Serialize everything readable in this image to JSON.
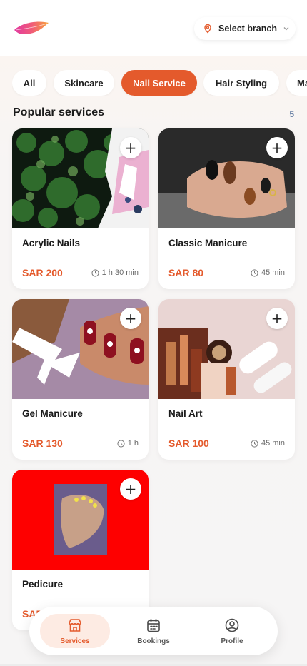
{
  "header": {
    "branch_label": "Select branch",
    "icons": [
      "feather-logo",
      "location-pin-icon",
      "chevron-down-icon"
    ]
  },
  "tabs": [
    {
      "label": "All",
      "active": false
    },
    {
      "label": "Skincare",
      "active": false
    },
    {
      "label": "Nail Service",
      "active": true
    },
    {
      "label": "Hair Styling",
      "active": false
    },
    {
      "label": "Ma",
      "active": false
    }
  ],
  "section": {
    "title": "Popular services",
    "count": "5"
  },
  "services": [
    {
      "name": "Acrylic Nails",
      "price": "SAR 200",
      "duration": "1 h 30 min"
    },
    {
      "name": "Classic Manicure",
      "price": "SAR 80",
      "duration": "45 min"
    },
    {
      "name": "Gel Manicure",
      "price": "SAR 130",
      "duration": "1 h"
    },
    {
      "name": "Nail Art",
      "price": "SAR 100",
      "duration": "45 min"
    },
    {
      "name": "Pedicure",
      "price": "SAR",
      "duration": ""
    }
  ],
  "add_label": "+",
  "nav": {
    "items": [
      {
        "label": "Services",
        "icon": "store-icon",
        "active": true
      },
      {
        "label": "Bookings",
        "icon": "calendar-icon",
        "active": false
      },
      {
        "label": "Profile",
        "icon": "user-circle-icon",
        "active": false
      }
    ]
  },
  "colors": {
    "accent": "#e45a2c",
    "count": "#6f86a8"
  }
}
